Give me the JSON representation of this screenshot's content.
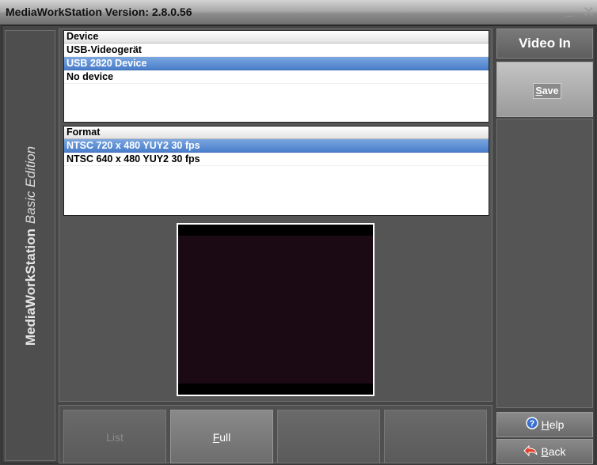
{
  "window": {
    "title": "MediaWorkStation Version: 2.8.0.56",
    "minimize_glyph": "_",
    "close_glyph": "✕"
  },
  "brand": {
    "name": "MediaWorkStation",
    "edition": "Basic Edition"
  },
  "device_list": {
    "header": "Device",
    "rows": [
      {
        "label": "USB-Videogerät",
        "selected": false
      },
      {
        "label": "USB 2820 Device",
        "selected": true
      },
      {
        "label": "No device",
        "selected": false
      }
    ]
  },
  "format_list": {
    "header": "Format",
    "rows": [
      {
        "label": "NTSC 720 x 480 YUY2 30 fps",
        "selected": true
      },
      {
        "label": "NTSC 640 x 480 YUY2 30 fps",
        "selected": false
      }
    ]
  },
  "tabs": [
    {
      "label_pre": "",
      "label_u": "",
      "label_post": "List",
      "enabled": false
    },
    {
      "label_pre": "",
      "label_u": "F",
      "label_post": "ull",
      "enabled": true
    },
    {
      "label_pre": "",
      "label_u": "",
      "label_post": "",
      "enabled": false
    },
    {
      "label_pre": "",
      "label_u": "",
      "label_post": "",
      "enabled": false
    }
  ],
  "right_panel": {
    "title": "Video In",
    "save": {
      "u": "S",
      "rest": "ave"
    },
    "help": {
      "u": "H",
      "rest": "elp",
      "icon": "help-circle-icon"
    },
    "back": {
      "u": "B",
      "rest": "ack",
      "icon": "back-arrow-icon"
    }
  },
  "colors": {
    "selection": "#4a7fcb",
    "preview_bg": "#1b0a14"
  }
}
